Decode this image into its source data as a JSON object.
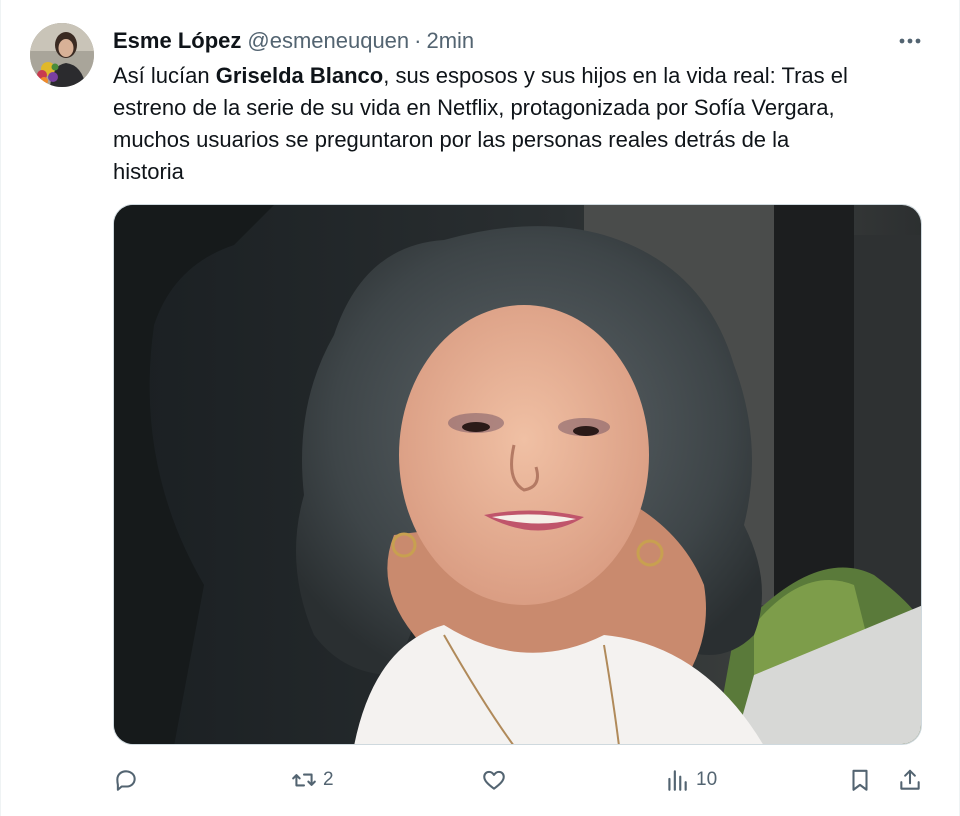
{
  "tweet": {
    "author_name": "Esme López",
    "author_handle": "@esmeneuquen",
    "separator": "·",
    "time": "2min",
    "more_label": "···",
    "text_line1_pre": "Así lucían ",
    "text_line1_bold": "Griselda Blanco",
    "text_line1_post": ", sus esposos y sus hijos en la vida real: Tras el",
    "text_line2": "estreno de la serie de su vida en Netflix, protagonizada por Sofía Vergara,",
    "text_line3": "muchos usuarios se preguntaron por las personas reales detrás de la",
    "text_line4": "historia"
  },
  "actions": {
    "reply_count": "",
    "retweet_count": "2",
    "like_count": "",
    "views_count": "10"
  },
  "icons": {
    "avatar": "avatar",
    "more": "more-horizontal-icon",
    "reply": "reply-icon",
    "retweet": "retweet-icon",
    "like": "heart-icon",
    "views": "views-icon",
    "bookmark": "bookmark-icon",
    "share": "share-icon"
  },
  "colors": {
    "text_primary": "#0f1419",
    "text_secondary": "#536471",
    "border": "#cfd9de"
  }
}
